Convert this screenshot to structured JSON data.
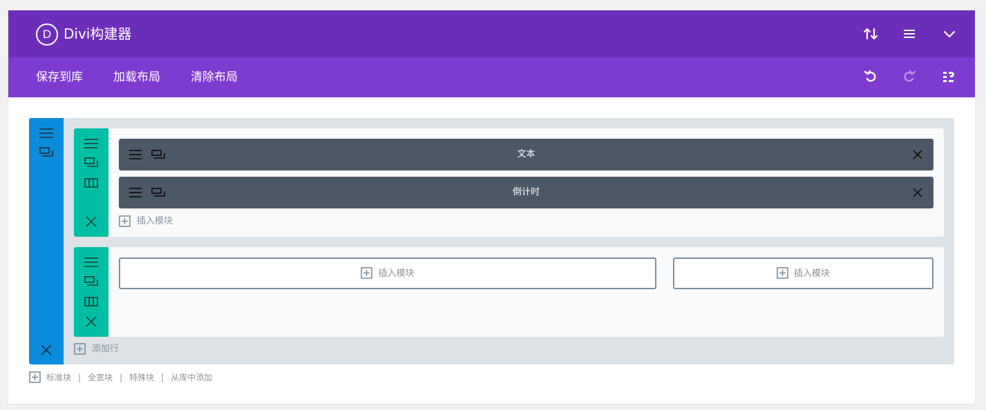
{
  "header": {
    "logo_letter": "D",
    "title": "Divi构建器",
    "icons": [
      "sort-arrows-icon",
      "hamburger-menu-icon",
      "chevron-down-icon"
    ]
  },
  "toolbar": {
    "links": [
      "保存到库",
      "加载布局",
      "清除布局"
    ],
    "icons": [
      "undo-icon",
      "redo-icon",
      "history-icon"
    ]
  },
  "section": {
    "rows": [
      {
        "modules": [
          {
            "label": "文本"
          },
          {
            "label": "倒计时"
          }
        ],
        "insert_label": "插入模块"
      },
      {
        "columns": [
          {
            "insert_label": "插入模块"
          },
          {
            "insert_label": "插入模块"
          }
        ]
      }
    ],
    "add_row_label": "添加行"
  },
  "footer": {
    "links": [
      "标准块",
      "全宽块",
      "特殊块",
      "从库中添加"
    ],
    "separator": "|"
  },
  "colors": {
    "header": "#6c2eb9",
    "subbar": "#7e3bd0",
    "section": "#0c8cdc",
    "row": "#00bfa5",
    "module": "#4c5866"
  }
}
